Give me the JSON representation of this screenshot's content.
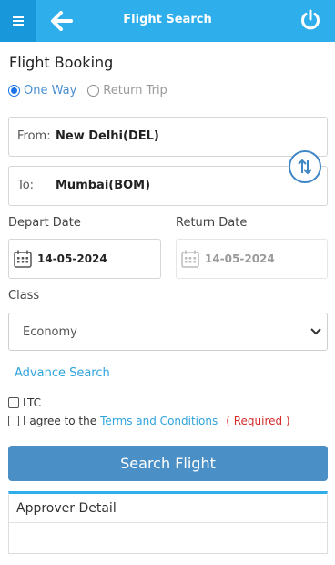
{
  "header": {
    "title": "Flight Search",
    "menu_icon": "hamburger-menu-icon",
    "back_icon": "arrow-left-icon",
    "power_icon": "power-icon",
    "accent_color": "#2faeec"
  },
  "form": {
    "heading": "Flight Booking",
    "trip_types": [
      {
        "label": "One Way",
        "selected": true
      },
      {
        "label": "Return Trip",
        "selected": false
      }
    ],
    "from": {
      "label": "From:",
      "value": "New Delhi(DEL)"
    },
    "to": {
      "label": "To:",
      "value": "Mumbai(BOM)"
    },
    "swap_icon": "swap-vertical-icon",
    "depart": {
      "label": "Depart Date",
      "value": "14-05-2024"
    },
    "return": {
      "label": "Return Date",
      "value": "14-05-2024"
    },
    "class": {
      "label": "Class",
      "value": "Economy"
    },
    "advance_search": "Advance Search",
    "ltc_label": "LTC",
    "agree_prefix": "I agree to the",
    "terms_link": "Terms and Conditions",
    "required": "( Required )",
    "submit_label": "Search Flight"
  },
  "approver": {
    "title": "Approver Detail"
  }
}
